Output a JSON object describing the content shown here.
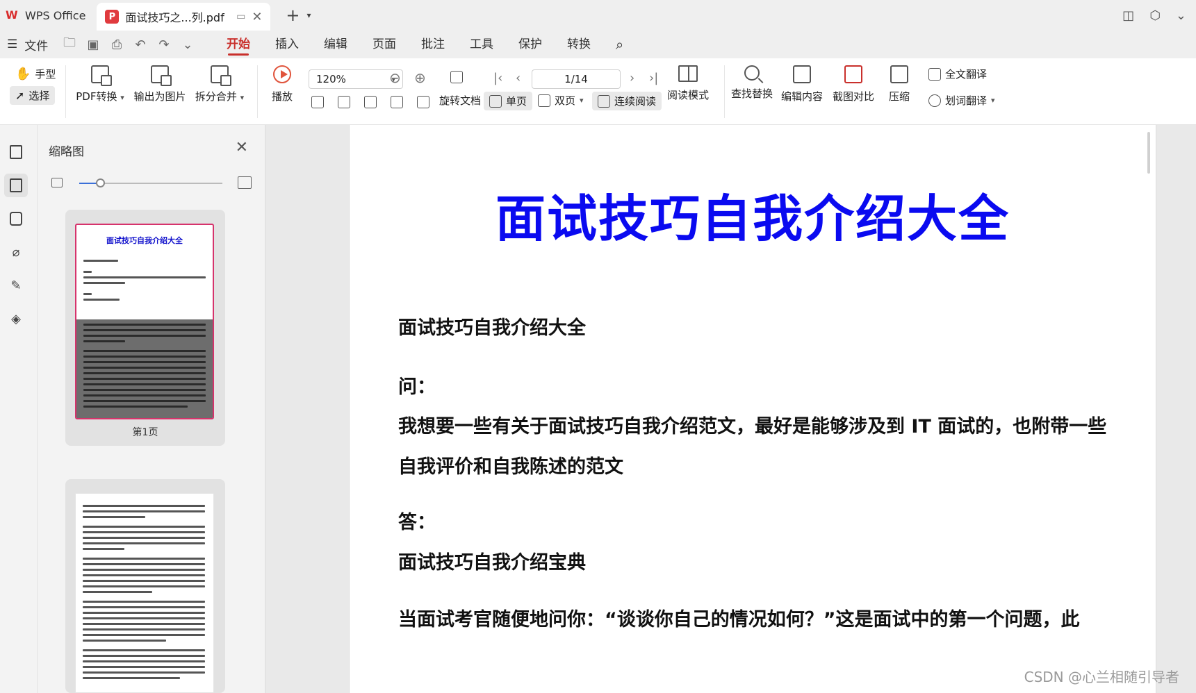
{
  "titlebar": {
    "app_name": "WPS Office",
    "doc_tab": "面试技巧之...列.pdf",
    "pdf_badge": "P",
    "close_glyph": "✕",
    "new_tab_glyph": "+",
    "caret": "⌄"
  },
  "menubar": {
    "file_label": "文件",
    "tabs": [
      "开始",
      "插入",
      "编辑",
      "页面",
      "批注",
      "工具",
      "保护",
      "转换"
    ],
    "active_tab": "开始"
  },
  "ribbon": {
    "hand": "手型",
    "select": "选择",
    "pdf_convert": "PDF转换",
    "export_image": "输出为图片",
    "split_merge": "拆分合并",
    "play": "播放",
    "zoom": "120%",
    "page": "1/14",
    "rotate": "旋转文档",
    "single_page": "单页",
    "double_page": "双页",
    "continuous": "连续阅读",
    "read_mode": "阅读模式",
    "find_replace": "查找替换",
    "edit_content": "编辑内容",
    "compare": "截图对比",
    "compress": "压缩",
    "full_translate": "全文翻译",
    "word_translate": "划词翻译"
  },
  "thumbnails": {
    "title": "缩略图",
    "page1_label": "第1页",
    "page1_title": "面试技巧自我介绍大全",
    "zoom_level": 0.12
  },
  "document": {
    "title": "面试技巧自我介绍大全",
    "heading": "面试技巧自我介绍大全",
    "q_label": "问：",
    "question_line1": "我想要一些有关于面试技巧自我介绍范文，最好是能够涉及到 IT 面试的，也附带一些",
    "question_line2": "自我评价和自我陈述的范文",
    "a_label": "答：",
    "answer_title": "面试技巧自我介绍宝典",
    "answer_line1": "当面试考官随便地问你：“谈谈你自己的情况如何？”这是面试中的第一个问题，此",
    "watermark": "CSDN @心兰相随引导者"
  },
  "icons": [
    "wps-logo",
    "pdf-icon",
    "hand-icon",
    "cursor-icon",
    "play-icon",
    "search-icon",
    "bookmark-icon",
    "thumbnail-icon",
    "comment-icon",
    "attachment-icon",
    "signature-icon",
    "layers-icon"
  ],
  "colors": {
    "accent": "#c9302c",
    "title_blue": "#0a0af0",
    "pdf_red": "#e03a3e"
  }
}
